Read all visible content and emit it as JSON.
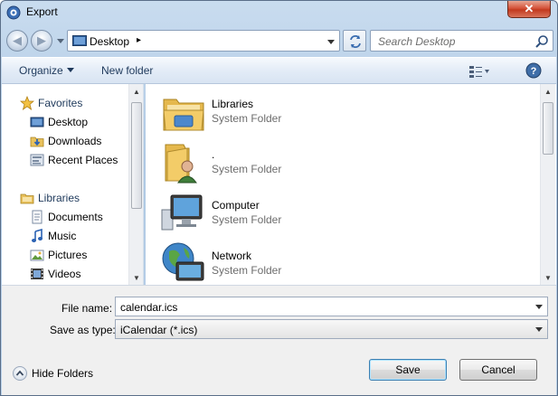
{
  "window": {
    "title": "Export",
    "close_label": "✕"
  },
  "nav": {
    "back_label": "◀",
    "forward_label": "▶"
  },
  "address_bar": {
    "location": "Desktop",
    "separator": "▸"
  },
  "search": {
    "placeholder": "Search Desktop"
  },
  "toolbar": {
    "organize_label": "Organize",
    "new_folder_label": "New folder",
    "help_label": "?"
  },
  "nav_pane": {
    "groups": [
      {
        "label": "Favorites",
        "icon": "star-icon",
        "items": [
          {
            "label": "Desktop",
            "icon": "desktop-icon"
          },
          {
            "label": "Downloads",
            "icon": "downloads-folder-icon"
          },
          {
            "label": "Recent Places",
            "icon": "recent-places-icon"
          }
        ]
      },
      {
        "label": "Libraries",
        "icon": "libraries-icon",
        "items": [
          {
            "label": "Documents",
            "icon": "documents-icon"
          },
          {
            "label": "Music",
            "icon": "music-icon"
          },
          {
            "label": "Pictures",
            "icon": "pictures-icon"
          },
          {
            "label": "Videos",
            "icon": "videos-icon"
          }
        ]
      }
    ]
  },
  "files": [
    {
      "name": "Libraries",
      "type": "System Folder",
      "icon": "libraries-folder-icon"
    },
    {
      "name": ".",
      "type": "System Folder",
      "icon": "user-folder-icon"
    },
    {
      "name": "Computer",
      "type": "System Folder",
      "icon": "computer-icon"
    },
    {
      "name": "Network",
      "type": "System Folder",
      "icon": "network-icon"
    }
  ],
  "form": {
    "file_name_label": "File name:",
    "file_name_value": "calendar.ics",
    "save_type_label": "Save as type:",
    "save_type_value": "iCalendar (*.ics)"
  },
  "footer": {
    "hide_folders_label": "Hide Folders",
    "save_label": "Save",
    "cancel_label": "Cancel"
  },
  "colors": {
    "title_gradient": "#aec8e3",
    "close_red": "#c23a1f",
    "link_text": "#1e395b",
    "secondary_text": "#6d6d6d"
  }
}
